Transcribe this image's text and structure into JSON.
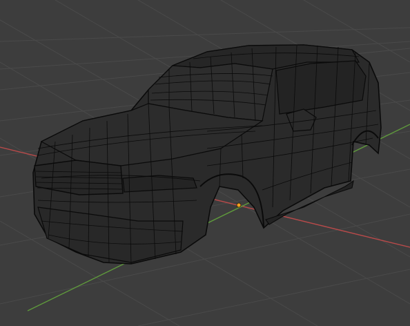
{
  "viewport": {
    "background": "#3d3d3d",
    "grid_color": "#4a4a4a",
    "x_axis_color": "#b84a4a",
    "y_axis_color": "#5f9a3c",
    "mesh_fill": "#2a2a2a",
    "wire_color": "#0a0a0a",
    "origin_color": "#f0a020"
  },
  "scene": {
    "object_type": "wireframe-car-mesh",
    "mode": "edit-mode-wireframe"
  }
}
